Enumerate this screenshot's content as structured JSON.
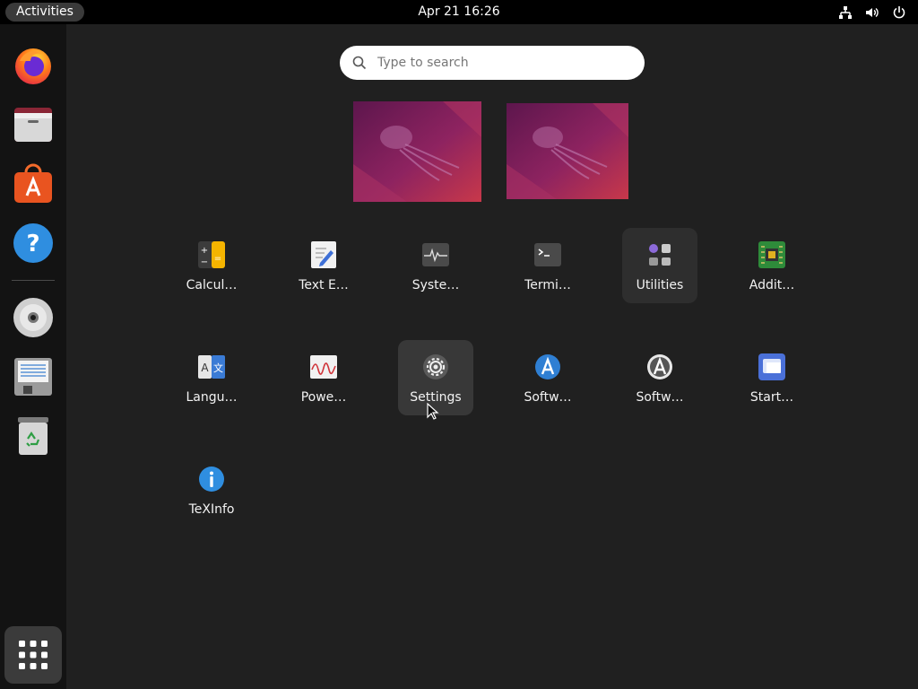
{
  "topbar": {
    "activities_label": "Activities",
    "clock": "Apr 21  16:26",
    "tray_icons": [
      "network-icon",
      "volume-icon",
      "power-icon"
    ]
  },
  "dock": {
    "items": [
      {
        "name": "firefox",
        "icon": "firefox-icon"
      },
      {
        "name": "files",
        "icon": "files-icon"
      },
      {
        "name": "ubuntu-software",
        "icon": "ubuntu-software-icon"
      },
      {
        "name": "help",
        "icon": "help-icon"
      },
      {
        "name": "dvd",
        "icon": "disc-icon"
      },
      {
        "name": "floppy",
        "icon": "floppy-icon"
      },
      {
        "name": "trash",
        "icon": "trash-icon"
      }
    ],
    "show_apps_icon": "grid-icon"
  },
  "search": {
    "placeholder": "Type to search"
  },
  "apps": [
    {
      "label": "Calcul…",
      "icon": "calculator-icon"
    },
    {
      "label": "Text E…",
      "icon": "text-editor-icon"
    },
    {
      "label": "Syste…",
      "icon": "system-monitor-icon"
    },
    {
      "label": "Termi…",
      "icon": "terminal-icon"
    },
    {
      "label": "Utilities",
      "icon": "utilities-folder-icon"
    },
    {
      "label": "Addit…",
      "icon": "additional-drivers-icon"
    },
    {
      "label": "Langu…",
      "icon": "language-icon"
    },
    {
      "label": "Powe…",
      "icon": "power-statistics-icon"
    },
    {
      "label": "Settings",
      "icon": "settings-icon"
    },
    {
      "label": "Softw…",
      "icon": "software-updater-icon"
    },
    {
      "label": "Softw…",
      "icon": "software-properties-icon"
    },
    {
      "label": "Start…",
      "icon": "startup-disk-icon"
    },
    {
      "label": "TeXInfo",
      "icon": "info-icon"
    }
  ],
  "colors": {
    "accent": "#e95420",
    "wallpaper_start": "#6b1a55",
    "wallpaper_end": "#c83a4a"
  }
}
